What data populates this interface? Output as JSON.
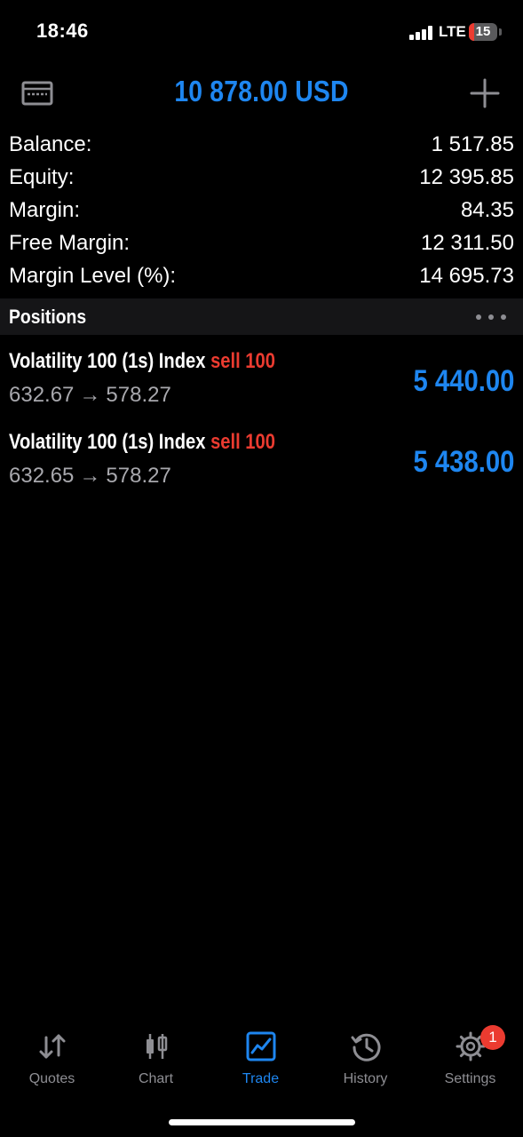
{
  "status_bar": {
    "time": "18:46",
    "network": "LTE",
    "battery": "15"
  },
  "header": {
    "title": "10 878.00 USD",
    "left_icon": "wallet-icon",
    "right_icon": "add-icon"
  },
  "summary": [
    {
      "label": "Balance:",
      "value": "1 517.85"
    },
    {
      "label": "Equity:",
      "value": "12 395.85"
    },
    {
      "label": "Margin:",
      "value": "84.35"
    },
    {
      "label": "Free Margin:",
      "value": "12 311.50"
    },
    {
      "label": "Margin Level (%):",
      "value": "14 695.73"
    }
  ],
  "positions": {
    "title": "Positions",
    "menu_icon": "more-icon",
    "items": [
      {
        "symbol": "Volatility 100 (1s) Index",
        "side": "sell 100",
        "open_price": "632.67",
        "arrow": "→",
        "current_price": "578.27",
        "profit": "5 440.00"
      },
      {
        "symbol": "Volatility 100 (1s) Index",
        "side": "sell 100",
        "open_price": "632.65",
        "arrow": "→",
        "current_price": "578.27",
        "profit": "5 438.00"
      }
    ]
  },
  "tabs": [
    {
      "label": "Quotes",
      "icon": "quotes-icon",
      "active": false
    },
    {
      "label": "Chart",
      "icon": "chart-icon",
      "active": false
    },
    {
      "label": "Trade",
      "icon": "trade-icon",
      "active": true
    },
    {
      "label": "History",
      "icon": "history-icon",
      "active": false
    },
    {
      "label": "Settings",
      "icon": "settings-icon",
      "active": false,
      "badge": "1"
    }
  ],
  "colors": {
    "accent": "#1e86f0",
    "sell": "#eb3b30",
    "muted": "#8e8e93",
    "background": "#000000"
  }
}
